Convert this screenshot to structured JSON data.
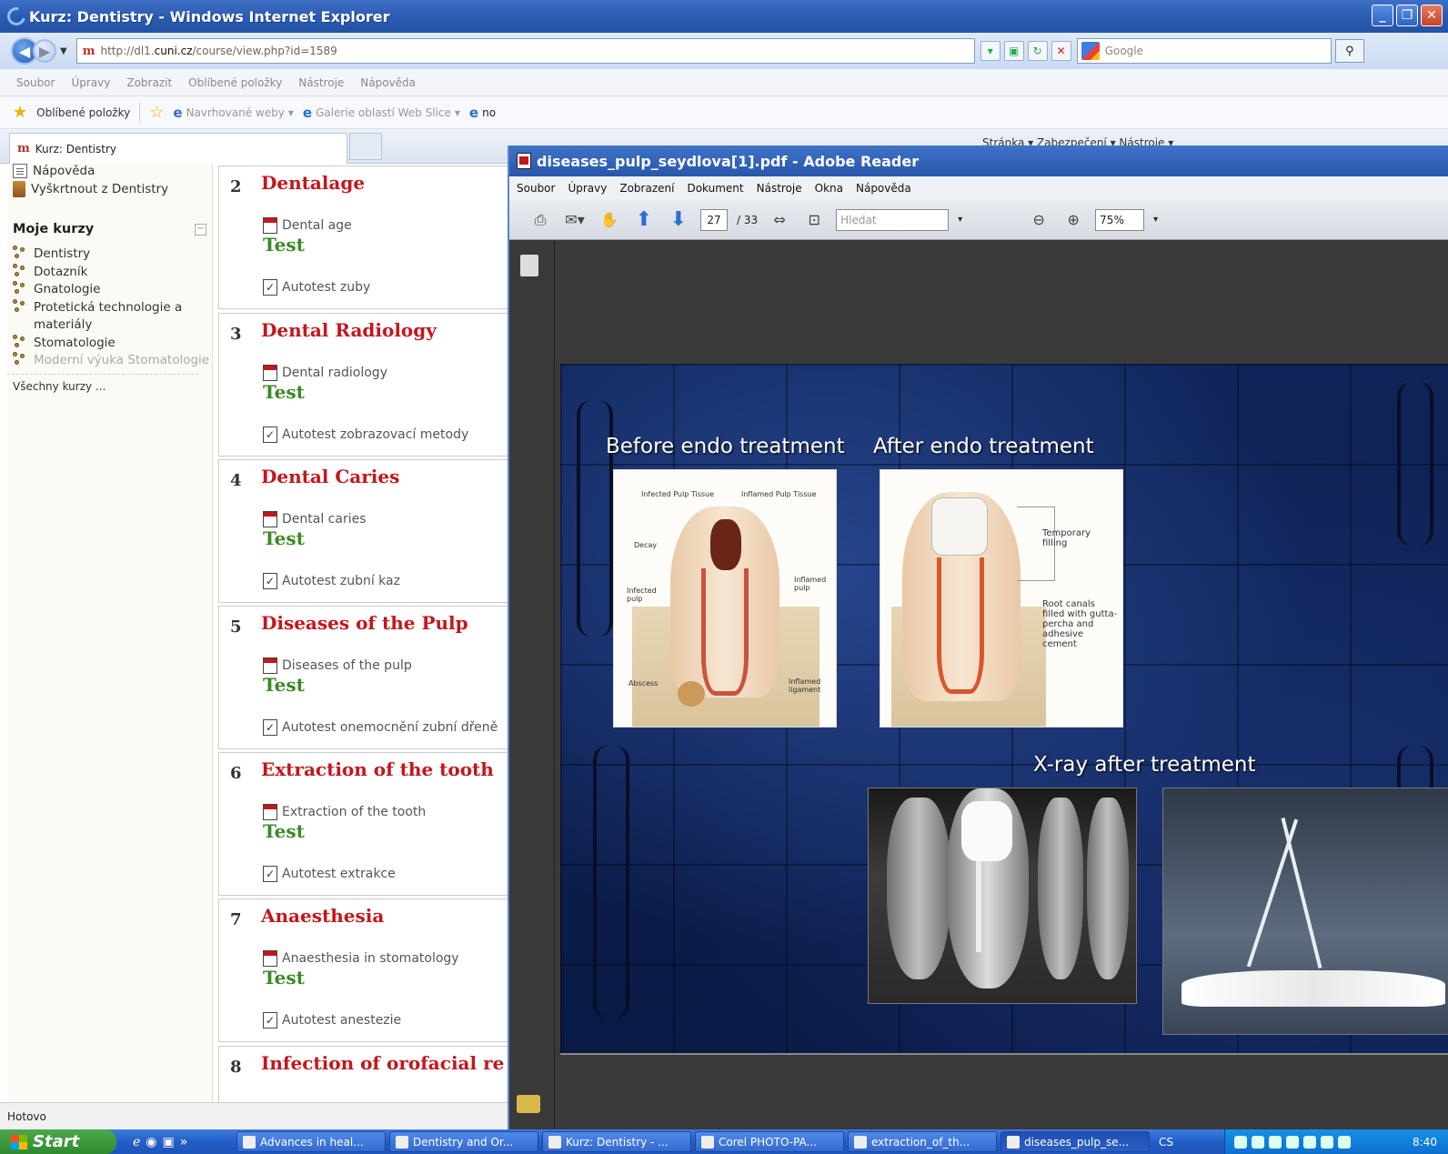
{
  "ie": {
    "title": "Kurz: Dentistry - Windows Internet Explorer",
    "url_prefix": "http://dl1.",
    "url_host": "cuni.cz",
    "url_path": "/course/view.php?id=1589",
    "search_placeholder": "Google",
    "menu": [
      "Soubor",
      "Úpravy",
      "Zobrazit",
      "Oblíbené položky",
      "Nástroje",
      "Nápověda"
    ],
    "favorites_label": "Oblíbené položky",
    "favorites": [
      "Navrhované weby",
      "Galerie oblastí Web Slice",
      "no"
    ],
    "tab_title": "Kurz: Dentistry",
    "command_bar": "Stránka ▾   Zabezpečení ▾   Nástroje ▾",
    "status": "Hotovo"
  },
  "sidebar": {
    "help": "Nápověda",
    "unenrol": "Vyškrtnout z Dentistry",
    "my_courses_title": "Moje kurzy",
    "courses": [
      "Dentistry",
      "Dotazník",
      "Gnatologie",
      "Protetická technologie a materiály",
      "Stomatologie",
      "Moderní výuka Stomatologie"
    ],
    "all_courses": "Všechny kurzy ..."
  },
  "sections": [
    {
      "num": "2",
      "title": "Dentalage",
      "resource": "Dental age",
      "test": "Test",
      "quiz": "Autotest zuby"
    },
    {
      "num": "3",
      "title": "Dental Radiology",
      "resource": "Dental radiology",
      "test": "Test",
      "quiz": "Autotest zobrazovací metody"
    },
    {
      "num": "4",
      "title": "Dental Caries",
      "resource": "Dental caries",
      "test": "Test",
      "quiz": "Autotest zubní kaz"
    },
    {
      "num": "5",
      "title": "Diseases of the Pulp",
      "resource": "Diseases of the pulp",
      "test": "Test",
      "quiz": "Autotest onemocnění zubní dřeně"
    },
    {
      "num": "6",
      "title": "Extraction of the tooth",
      "resource": "Extraction of the tooth",
      "test": "Test",
      "quiz": "Autotest extrakce"
    },
    {
      "num": "7",
      "title": "Anaesthesia",
      "resource": "Anaesthesia in stomatology",
      "test": "Test",
      "quiz": "Autotest anestezie"
    },
    {
      "num": "8",
      "title": "Infection of orofacial re",
      "resource": "",
      "test": "",
      "quiz": ""
    }
  ],
  "adobe": {
    "title": "diseases_pulp_seydlova[1].pdf - Adobe Reader",
    "menu": [
      "Soubor",
      "Úpravy",
      "Zobrazení",
      "Dokument",
      "Nástroje",
      "Okna",
      "Nápověda"
    ],
    "page_current": "27",
    "page_total": "/ 33",
    "find_placeholder": "Hledat",
    "zoom": "75%"
  },
  "slide": {
    "before": "Before endo treatment",
    "after": "After endo treatment",
    "xray": "X-ray after treatment",
    "labels_left": [
      "Infected Pulp Tissue",
      "Inflamed Pulp Tissue",
      "Decay",
      "Infected pulp",
      "Inflamed pulp",
      "Abscess",
      "Inflamed ligament"
    ],
    "labels_right": [
      "Temporary filling",
      "Root canals filled with gutta-percha and adhesive cement"
    ]
  },
  "taskbar": {
    "start": "Start",
    "tasks": [
      "Advances in heal...",
      "Dentistry and Or...",
      "Kurz: Dentistry - ...",
      "Corel PHOTO-PA...",
      "extraction_of_th...",
      "diseases_pulp_se..."
    ],
    "lang": "CS",
    "clock": "8:40"
  }
}
